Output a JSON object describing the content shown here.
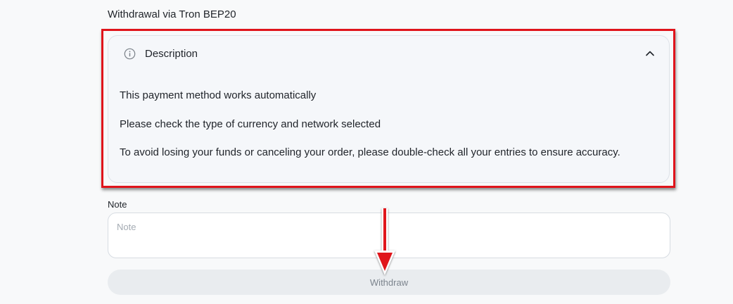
{
  "page": {
    "section_title": "Withdrawal via Tron BEP20"
  },
  "description": {
    "title": "Description",
    "info_icon": "info-circle-icon",
    "toggle_icon": "chevron-up-icon",
    "expanded": true,
    "lines": [
      "This payment method works automatically",
      "Please check the type of currency and network selected",
      "To avoid losing your funds or canceling your order, please double-check all your entries to ensure accuracy."
    ]
  },
  "note": {
    "label": "Note",
    "placeholder": "Note",
    "value": ""
  },
  "withdraw": {
    "label": "Withdraw",
    "disabled": true
  },
  "annotations": {
    "highlight_color": "#e0141b",
    "arrow_color": "#e0141b"
  }
}
